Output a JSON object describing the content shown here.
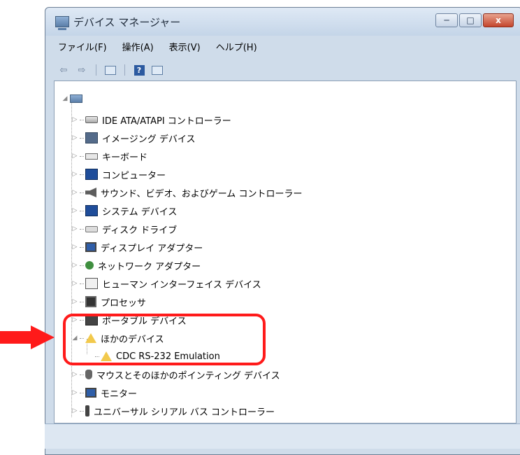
{
  "window": {
    "title": "デバイス マネージャー",
    "buttons": {
      "minimize": "─",
      "maximize": "□",
      "close": "x"
    }
  },
  "menu": [
    "ファイル(F)",
    "操作(A)",
    "表示(V)",
    "ヘルプ(H)"
  ],
  "toolbar": {
    "back": "⇦",
    "forward": "⇨",
    "help": "?"
  },
  "tree": {
    "root_expander": "◢",
    "items": [
      {
        "label": "IDE ATA/ATAPI コントローラー",
        "icon": "drive-icon"
      },
      {
        "label": "イメージング デバイス",
        "icon": "camera-icon"
      },
      {
        "label": "キーボード",
        "icon": "keyboard-icon"
      },
      {
        "label": "コンピューター",
        "icon": "computer-icon"
      },
      {
        "label": "サウンド、ビデオ、およびゲーム コントローラー",
        "icon": "speaker-icon"
      },
      {
        "label": "システム デバイス",
        "icon": "computer-icon"
      },
      {
        "label": "ディスク ドライブ",
        "icon": "disk-icon"
      },
      {
        "label": "ディスプレイ アダプター",
        "icon": "monitor-icon"
      },
      {
        "label": "ネットワーク アダプター",
        "icon": "network-icon"
      },
      {
        "label": "ヒューマン インターフェイス デバイス",
        "icon": "hid-icon"
      },
      {
        "label": "プロセッサ",
        "icon": "cpu-icon"
      },
      {
        "label": "ポータブル デバイス",
        "icon": "portable-icon"
      },
      {
        "label": "ほかのデバイス",
        "icon": "warning-icon",
        "expanded": true
      },
      {
        "label": "CDC RS-232 Emulation",
        "icon": "warning-icon",
        "child": true
      },
      {
        "label": "マウスとそのほかのポインティング デバイス",
        "icon": "mouse-icon"
      },
      {
        "label": "モニター",
        "icon": "monitor-icon"
      },
      {
        "label": "ユニバーサル シリアル バス コントローラー",
        "icon": "usb-icon"
      }
    ],
    "expander_collapsed": "▷",
    "expander_expanded": "◢"
  },
  "annotation_color": "#ff1a1a"
}
